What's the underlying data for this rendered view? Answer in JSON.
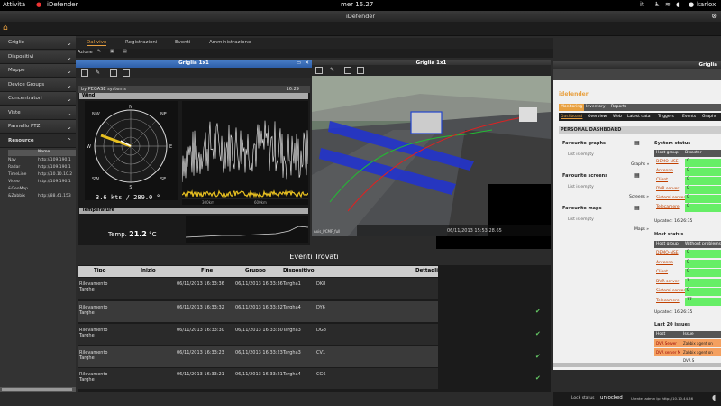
{
  "topbar": {
    "activities": "Attività",
    "app": "iDefender",
    "clock": "mer 16.27",
    "lang": "it",
    "user": "karlox"
  },
  "window_title": "iDefender",
  "sidebar": {
    "items": [
      {
        "label": "Griglie"
      },
      {
        "label": "Dispositivi"
      },
      {
        "label": "Mappe"
      },
      {
        "label": "Device Groups"
      },
      {
        "label": "Concentratori"
      },
      {
        "label": "Viste"
      },
      {
        "label": "Pannello PTZ"
      }
    ],
    "resource_label": "Resource",
    "resource_header": "Name",
    "resources": [
      {
        "name": "Nav",
        "url": "http://109.190.1"
      },
      {
        "name": "Radar",
        "url": "http://109.190.1"
      },
      {
        "name": "TimeLine",
        "url": "http://10.10.10.2"
      },
      {
        "name": "Video",
        "url": "http://109.190.1"
      },
      {
        "name": "&GeoMap",
        "url": ""
      },
      {
        "name": "&Zabbix",
        "url": "http://88.41.153"
      }
    ]
  },
  "tabs": [
    "Dal vivo",
    "Registrazioni",
    "Eventi",
    "Amministrazione"
  ],
  "subtoolbar_label": "Azione",
  "grid_window_title": "Griglia 1x1",
  "camera_window_title": "Griglia 1x1",
  "weather": {
    "brand": "by PEGASE systems",
    "time": "16:29",
    "wind_label": "Wind",
    "wind_speed": "3.6 kts",
    "wind_dir": "289.0 °",
    "compass": [
      "N",
      "NE",
      "E",
      "SE",
      "S",
      "SW",
      "W",
      "NW"
    ],
    "temp_section": "Temperature",
    "temp_label": "Temp.",
    "temp_value": "21.2",
    "temp_unit": "°C",
    "chart_tick_a": "300km",
    "chart_tick_b": "600km"
  },
  "camera": {
    "label": "Axis_PCMF_full",
    "timestamp": "06/11/2013 15:53:28.65"
  },
  "events": {
    "title": "Eventi Trovati",
    "columns": [
      "Tipo",
      "Inizio",
      "Fine",
      "Gruppo",
      "Dispositivo",
      "Dettagli"
    ],
    "rows": [
      {
        "tipo": "Rilevamento Targhe",
        "inizio": "06/11/2013 16:33:36",
        "fine": "06/11/2013 16:33:36",
        "dispositivo": "Targha1",
        "dettagli": "DK8"
      },
      {
        "tipo": "Rilevamento Targhe",
        "inizio": "06/11/2013 16:33:32",
        "fine": "06/11/2013 16:33:32",
        "dispositivo": "Targha4",
        "dettagli": "DY6"
      },
      {
        "tipo": "Rilevamento Targhe",
        "inizio": "06/11/2013 16:33:30",
        "fine": "06/11/2013 16:33:30",
        "dispositivo": "Targha3",
        "dettagli": "DG8"
      },
      {
        "tipo": "Rilevamento Targhe",
        "inizio": "06/11/2013 16:33:23",
        "fine": "06/11/2013 16:33:23",
        "dispositivo": "Targha3",
        "dettagli": "CV1"
      },
      {
        "tipo": "Rilevamento Targhe",
        "inizio": "06/11/2013 16:33:21",
        "fine": "06/11/2013 16:33:21",
        "dispositivo": "Targha4",
        "dettagli": "CG6"
      }
    ]
  },
  "idefender": {
    "title": "Griglia",
    "logo": "idefender",
    "nav": [
      "Monitoring",
      "Inventory",
      "Reports"
    ],
    "subnav": [
      "Dashboard",
      "Overview",
      "Web",
      "Latest data",
      "Triggers",
      "Events",
      "Graphs"
    ],
    "dashboard_title": "PERSONAL DASHBOARD",
    "fav_graphs": "Favourite graphs",
    "fav_screens": "Favourite screens",
    "fav_maps": "Favourite maps",
    "list_empty": "List is empty",
    "graphs_link": "Graphs »",
    "screens_link": "Screens »",
    "maps_link": "Maps »",
    "system_status": "System status",
    "host_group": "Host group",
    "disaster": "Disaster",
    "host_groups": [
      "DEMO-NSE",
      "Antenne",
      "Client",
      "DVR server",
      "Sistemi server",
      "Telecamere"
    ],
    "system_values": [
      "0",
      "0",
      "0",
      "0",
      "0",
      "0"
    ],
    "updated": "Updated: 16:26:35",
    "host_status": "Host status",
    "without_problems": "Without problems",
    "host_values": [
      "0",
      "0",
      "0",
      "1",
      "0",
      "17"
    ],
    "last20": "Last 20 issues",
    "host_col": "Host",
    "issue_col": "Issue",
    "issues": [
      {
        "host": "DVR Server",
        "issue": "Zabbix agent on DVR S"
      },
      {
        "host": "DVR server M",
        "issue": "Zabbix agent on DVR S"
      }
    ]
  },
  "statusbar": {
    "lock_status": "Lock status",
    "unlocked": "unlocked",
    "user_info": "Utente: admin  Ip: http://10.10.44.86"
  }
}
